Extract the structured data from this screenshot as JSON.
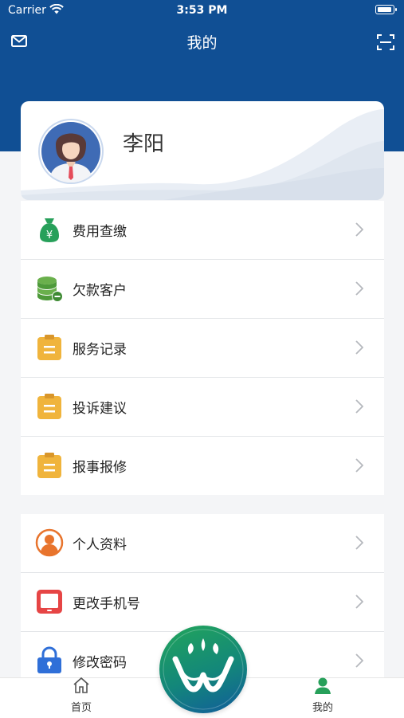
{
  "status_bar": {
    "carrier": "Carrier",
    "time": "3:53 PM"
  },
  "nav": {
    "title": "我的",
    "left_icon": "mail-icon",
    "right_icon": "scan-icon"
  },
  "profile": {
    "name": "李阳"
  },
  "menu_group_1": [
    {
      "label": "费用查缴",
      "icon": "money-bag-icon"
    },
    {
      "label": "欠款客户",
      "icon": "coin-stack-icon"
    },
    {
      "label": "服务记录",
      "icon": "clipboard-icon"
    },
    {
      "label": "投诉建议",
      "icon": "clipboard-icon"
    },
    {
      "label": "报事报修",
      "icon": "clipboard-icon"
    }
  ],
  "menu_group_2": [
    {
      "label": "个人资料",
      "icon": "person-icon"
    },
    {
      "label": "更改手机号",
      "icon": "phone-icon"
    },
    {
      "label": "修改密码",
      "icon": "lock-icon"
    }
  ],
  "tabbar": {
    "home_label": "首页",
    "mine_label": "我的"
  },
  "colors": {
    "header": "#104f94",
    "accent_green": "#27a05a",
    "clipboard": "#f0b43c",
    "person": "#e8742d",
    "phone": "#e64545",
    "lock": "#2f6fd8"
  }
}
